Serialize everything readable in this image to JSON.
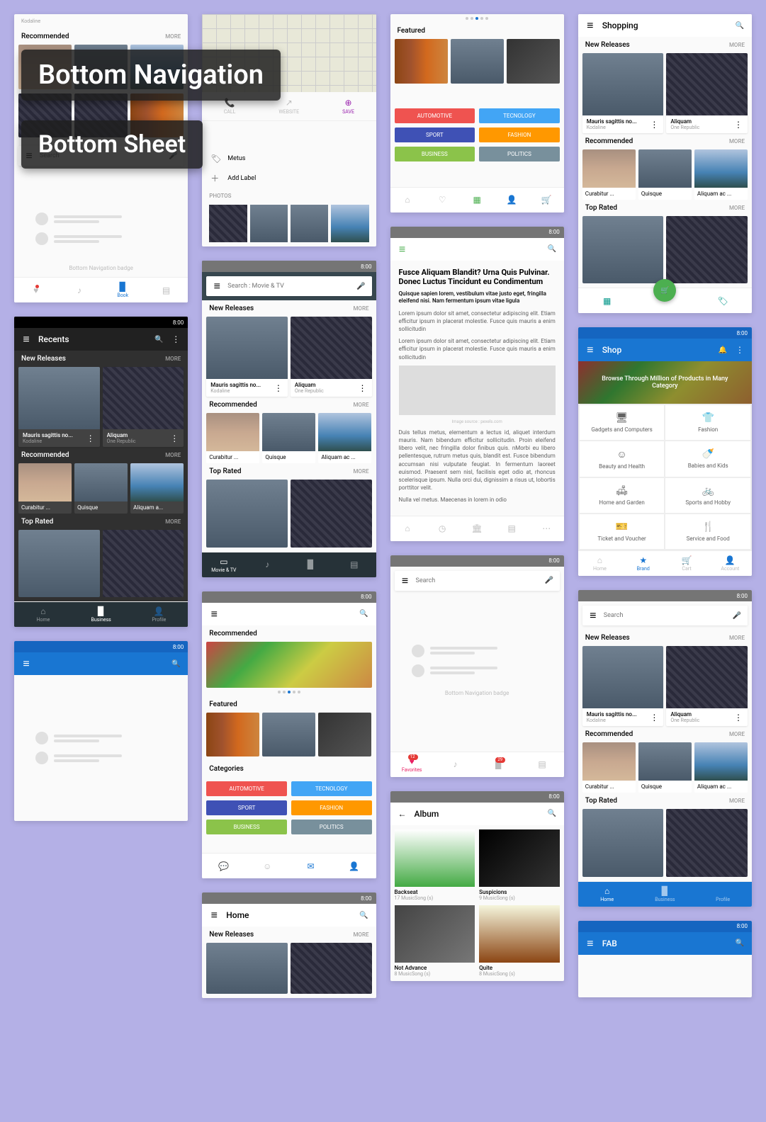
{
  "overlay": {
    "title1": "Bottom Navigation",
    "title2": "Bottom Sheet"
  },
  "status_time": "8:00",
  "common": {
    "more": "MORE",
    "search": "Search"
  },
  "sections": {
    "new_releases": "New Releases",
    "recommended": "Recommended",
    "top_rated": "Top Rated",
    "featured": "Featured",
    "categories": "Categories",
    "photos": "PHOTOS"
  },
  "items": {
    "mauris": {
      "title": "Mauris sagittis no...",
      "sub": "Kodaline"
    },
    "aliquam": {
      "title": "Aliquam",
      "sub": "One Republic"
    },
    "curabitur": "Curabitur ...",
    "quisque": "Quisque",
    "aliquam_ac": "Aliquam ac ...",
    "aliquam_a": "Aliquam a..."
  },
  "categories": {
    "automotive": "AUTOMOTIVE",
    "technology": "TECNOLOGY",
    "sport": "SPORT",
    "fashion": "FASHION",
    "business": "BUSINESS",
    "politics": "POLITICS"
  },
  "bottomnav": {
    "home": "Home",
    "business": "Business",
    "profile": "Profile",
    "book": "Book",
    "favorites": "Favorites",
    "brand": "Brand",
    "cart": "Cart",
    "account": "Account",
    "movie_tv": "Movie & TV",
    "badge_caption": "Bottom Navigation badge"
  },
  "contact": {
    "call": "CALL",
    "website": "WEBSITE",
    "save": "SAVE",
    "metus": "Metus",
    "add_label": "Add Label"
  },
  "search_movie": "Search : Movie & TV",
  "recents": {
    "title": "Recents"
  },
  "home_title": "Home",
  "shopping": {
    "title": "Shopping",
    "shop": "Shop",
    "hero": "Browse Through Million of Products in Many Category",
    "gadgets": "Gadgets and Computers",
    "fashion": "Fashion",
    "beauty": "Beauty and Health",
    "babies": "Babies and Kids",
    "home_garden": "Home and Garden",
    "sports": "Sports and Hobby",
    "ticket": "Ticket and Voucher",
    "service": "Service and Food"
  },
  "article": {
    "title": "Fusce Aliquam Blandit? Urna Quis Pulvinar. Donec Luctus Tincidunt eu Condimentum",
    "lead": "Quisque sapien lorem, vestibulum vitae justo eget, fringilla eleifend nisi. Nam fermentum ipsum vitae ligula",
    "p1": "Lorem ipsum dolor sit amet, consectetur adipiscing elit. Etiam efficitur ipsum in placerat molestie. Fusce quis mauris a enim sollicitudin",
    "p2": "Lorem ipsum dolor sit amet, consectetur adipiscing elit. Etiam efficitur ipsum in placerat molestie. Fusce quis mauris a enim sollicitudin",
    "figcap": "Image source : pexels.com",
    "p3": "Duis tellus metus, elementum a lectus id, aliquet interdum mauris. Nam bibendum efficitur sollicitudin. Proin eleifend libero velit, nec fringilla dolor finibus quis. nMorbi eu libero pellentesque, rutrum metus quis, blandit est. Fusce bibendum accumsan nisi vulputate feugiat. In fermentum laoreet euismod. Praesent sem nisl, facilisis eget odio at, rhoncus scelerisque ipsum. Nulla orci dui, dignissim a risus ut, lobortis porttitor velit.",
    "p4": "Nulla vel metus. Maecenas in lorem in odio"
  },
  "album": {
    "title": "Album",
    "backseat": {
      "t": "Backseat",
      "s": "17 MusicSong (s)"
    },
    "suspicions": {
      "t": "Suspicions",
      "s": "9 MusicSong (s)"
    },
    "not_advance": {
      "t": "Not Advance",
      "s": "8 MusicSong (s)"
    },
    "quite": {
      "t": "Quite",
      "s": "8 MusicSong (s)"
    }
  },
  "fab_title": "FAB"
}
